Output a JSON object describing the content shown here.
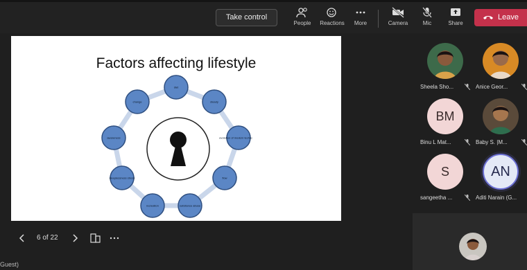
{
  "toolbar": {
    "take_control": "Take control",
    "people": "People",
    "reactions": "Reactions",
    "more": "More",
    "camera": "Camera",
    "mic": "Mic",
    "share": "Share",
    "leave": "Leave"
  },
  "slide": {
    "title": "Factors affecting lifestyle",
    "nodes": [
      "diet",
      "steady",
      "evolution of modern technology",
      "flow",
      "substance abuse",
      "recreation",
      "sleeplessness stress",
      "awareness",
      "change"
    ]
  },
  "presenter": {
    "page_indicator": "6 of 22"
  },
  "participants": [
    {
      "name": "Sheela Sho...",
      "type": "photo"
    },
    {
      "name": "Anice Geor...",
      "type": "photo"
    },
    {
      "name": "Binu L Mat...",
      "type": "initials",
      "initials": "BM"
    },
    {
      "name": "Baby S. |M...",
      "type": "photo"
    },
    {
      "name": "sangeetha ...",
      "type": "initials",
      "initials": "S"
    },
    {
      "name": "Aditi Narain (G...",
      "type": "initials",
      "initials": "AN"
    }
  ],
  "footer": {
    "guest_label": "Guest)"
  },
  "colors": {
    "leave": "#c4314b",
    "node": "#5b86c5",
    "ring_accent": "#6b6fd3"
  }
}
